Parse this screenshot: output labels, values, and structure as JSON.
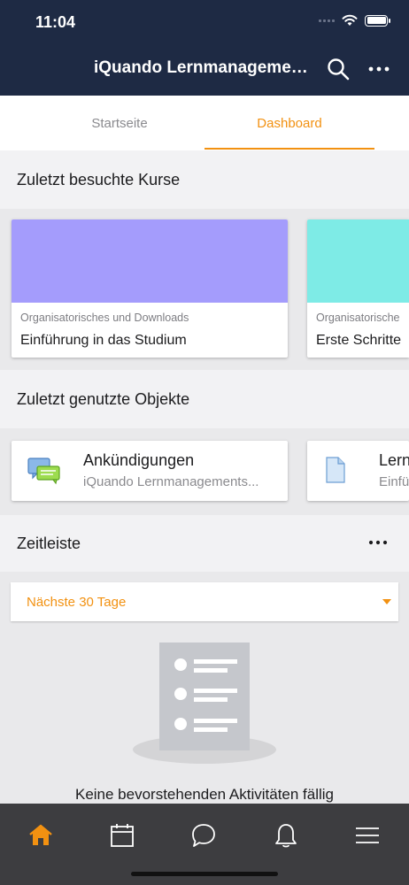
{
  "status": {
    "time": "11:04"
  },
  "header": {
    "title": "iQuando Lernmanagement..."
  },
  "tabs": [
    {
      "label": "Startseite",
      "active": false
    },
    {
      "label": "Dashboard",
      "active": true
    }
  ],
  "sections": {
    "recent_courses": "Zuletzt besuchte Kurse",
    "recent_objects": "Zuletzt genutzte Objekte",
    "timeline": "Zeitleiste"
  },
  "courses": [
    {
      "category": "Organisatorisches und Downloads",
      "name": "Einführung in das Studium",
      "color": "#a49cfc"
    },
    {
      "category": "Organisatorische",
      "name": "Erste Schritte",
      "color": "#7eebe6"
    }
  ],
  "objects": [
    {
      "title": "Ankündigungen",
      "subtitle": "iQuando Lernmanagements...",
      "icon": "forum-icon"
    },
    {
      "title": "Lern",
      "subtitle": "Einfü",
      "icon": "file-icon"
    }
  ],
  "timeline": {
    "filter_label": "Nächste 30 Tage",
    "empty_text": "Keine bevorstehenden Aktivitäten fällig"
  },
  "bottom_nav": [
    "home-icon",
    "calendar-icon",
    "messages-icon",
    "notifications-icon",
    "menu-icon"
  ],
  "colors": {
    "accent": "#f29111",
    "header": "#1e2a44",
    "nav": "#3d3d40"
  }
}
